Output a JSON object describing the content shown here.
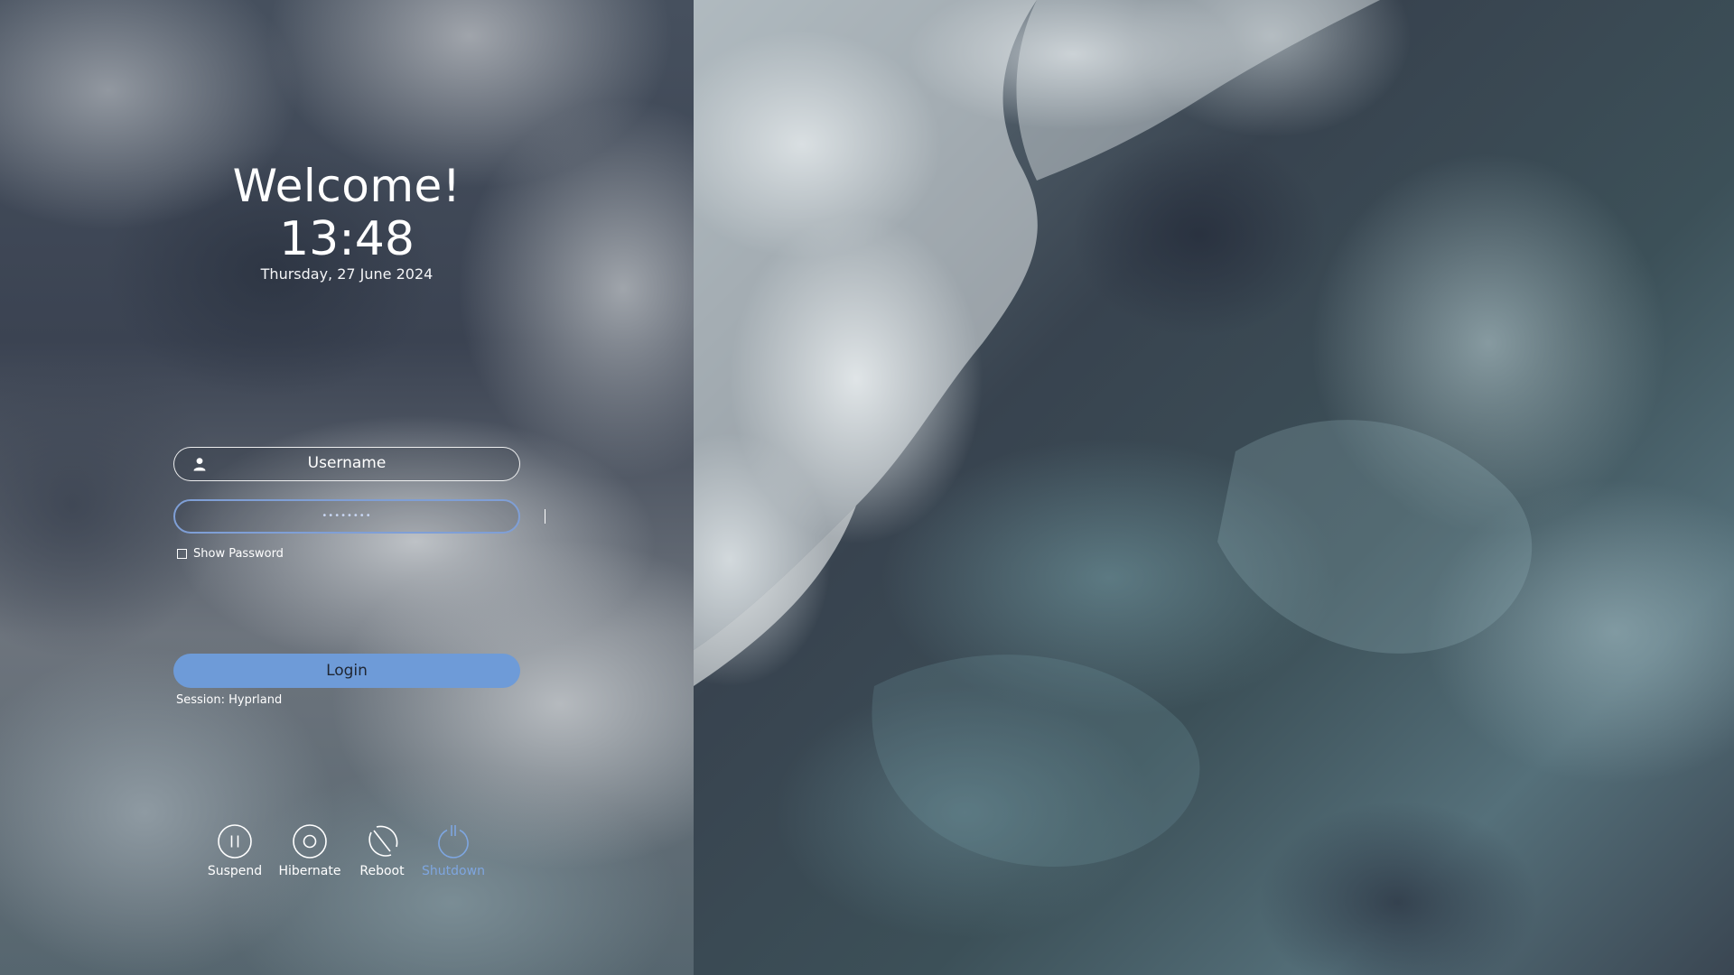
{
  "greeting": {
    "welcome": "Welcome!",
    "time": "13:48",
    "date": "Thursday, 27 June 2024"
  },
  "login_form": {
    "username_placeholder": "Username",
    "password_masked": "••••••••",
    "show_password_label": "Show Password",
    "show_password_checked": false,
    "login_label": "Login",
    "session_label": "Session: Hyprland"
  },
  "power": {
    "suspend": {
      "label": "Suspend",
      "icon": "pause-circle-icon"
    },
    "hibernate": {
      "label": "Hibernate",
      "icon": "hibernate-circle-icon"
    },
    "reboot": {
      "label": "Reboot",
      "icon": "reboot-icon"
    },
    "shutdown": {
      "label": "Shutdown",
      "icon": "power-icon"
    }
  },
  "colors": {
    "accent": "#6e9bd8",
    "focus_border": "#7f9fd6",
    "shutdown_highlight": "#7ea6e0",
    "text": "#ffffff"
  },
  "icons": {
    "username_field": "user-icon"
  }
}
